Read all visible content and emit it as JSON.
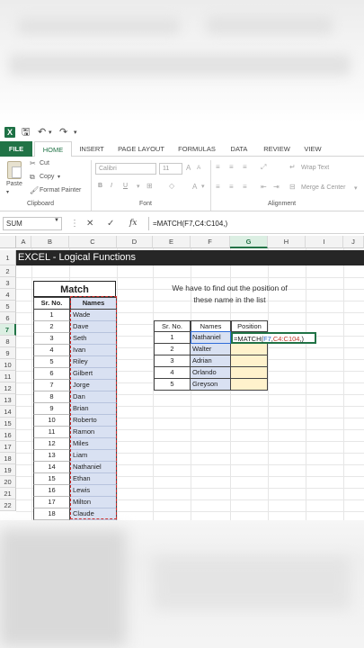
{
  "app": {
    "title_icon": "X",
    "quick_access": [
      "save-icon",
      "undo-icon",
      "redo-icon",
      "customize-icon"
    ]
  },
  "ribbon_tabs": [
    "FILE",
    "HOME",
    "INSERT",
    "PAGE LAYOUT",
    "FORMULAS",
    "DATA",
    "REVIEW",
    "VIEW"
  ],
  "ribbon": {
    "clipboard": {
      "paste": "Paste",
      "cut": "Cut",
      "copy": "Copy",
      "format_painter": "Format Painter",
      "label": "Clipboard"
    },
    "font": {
      "name": "Calibri",
      "size": "11",
      "bold": "B",
      "italic": "I",
      "underline": "U",
      "grow": "A",
      "shrink": "A",
      "color": "A",
      "label": "Font"
    },
    "alignment": {
      "wrap_text": "Wrap Text",
      "merge_center": "Merge & Center",
      "label": "Alignment"
    }
  },
  "formula_bar": {
    "name_box": "SUM",
    "cancel": "✕",
    "enter": "✓",
    "fx": "fx",
    "formula": "=MATCH(F7,C4:C104,)"
  },
  "columns": [
    "A",
    "B",
    "C",
    "D",
    "E",
    "F",
    "G",
    "H",
    "I",
    "J"
  ],
  "rows": [
    "1",
    "2",
    "3",
    "4",
    "5",
    "6",
    "7",
    "8",
    "9",
    "10",
    "11",
    "12",
    "13",
    "14",
    "15",
    "16",
    "17",
    "18",
    "19",
    "20",
    "21",
    "22"
  ],
  "banner": "EXCEL - Logical Functions",
  "match_table": {
    "title": "Match",
    "headers": [
      "Sr. No.",
      "Names"
    ],
    "rows": [
      [
        "1",
        "Wade"
      ],
      [
        "2",
        "Dave"
      ],
      [
        "3",
        "Seth"
      ],
      [
        "4",
        "Ivan"
      ],
      [
        "5",
        "Riley"
      ],
      [
        "6",
        "Gilbert"
      ],
      [
        "7",
        "Jorge"
      ],
      [
        "8",
        "Dan"
      ],
      [
        "9",
        "Brian"
      ],
      [
        "10",
        "Roberto"
      ],
      [
        "11",
        "Ramon"
      ],
      [
        "12",
        "Miles"
      ],
      [
        "13",
        "Liam"
      ],
      [
        "14",
        "Nathaniel"
      ],
      [
        "15",
        "Ethan"
      ],
      [
        "16",
        "Lewis"
      ],
      [
        "17",
        "Milton"
      ],
      [
        "18",
        "Claude"
      ]
    ]
  },
  "description": {
    "line1": "We have to find out the position of",
    "line2": "these name in the list"
  },
  "lookup_table": {
    "headers": [
      "Sr. No.",
      "Names",
      "Position"
    ],
    "rows": [
      [
        "1",
        "Nathaniel"
      ],
      [
        "2",
        "Walter"
      ],
      [
        "3",
        "Adrian"
      ],
      [
        "4",
        "Orlando"
      ],
      [
        "5",
        "Greyson"
      ]
    ],
    "editing": {
      "eq": "=MATCH(",
      "ref1": "F7",
      "sep1": ",",
      "ref2": "C4:C104",
      "tail": ",)"
    }
  },
  "colors": {
    "excel_green": "#217346",
    "names_fill": "#d9e1f2",
    "position_fill": "#fff2cc",
    "banner": "#262626"
  }
}
